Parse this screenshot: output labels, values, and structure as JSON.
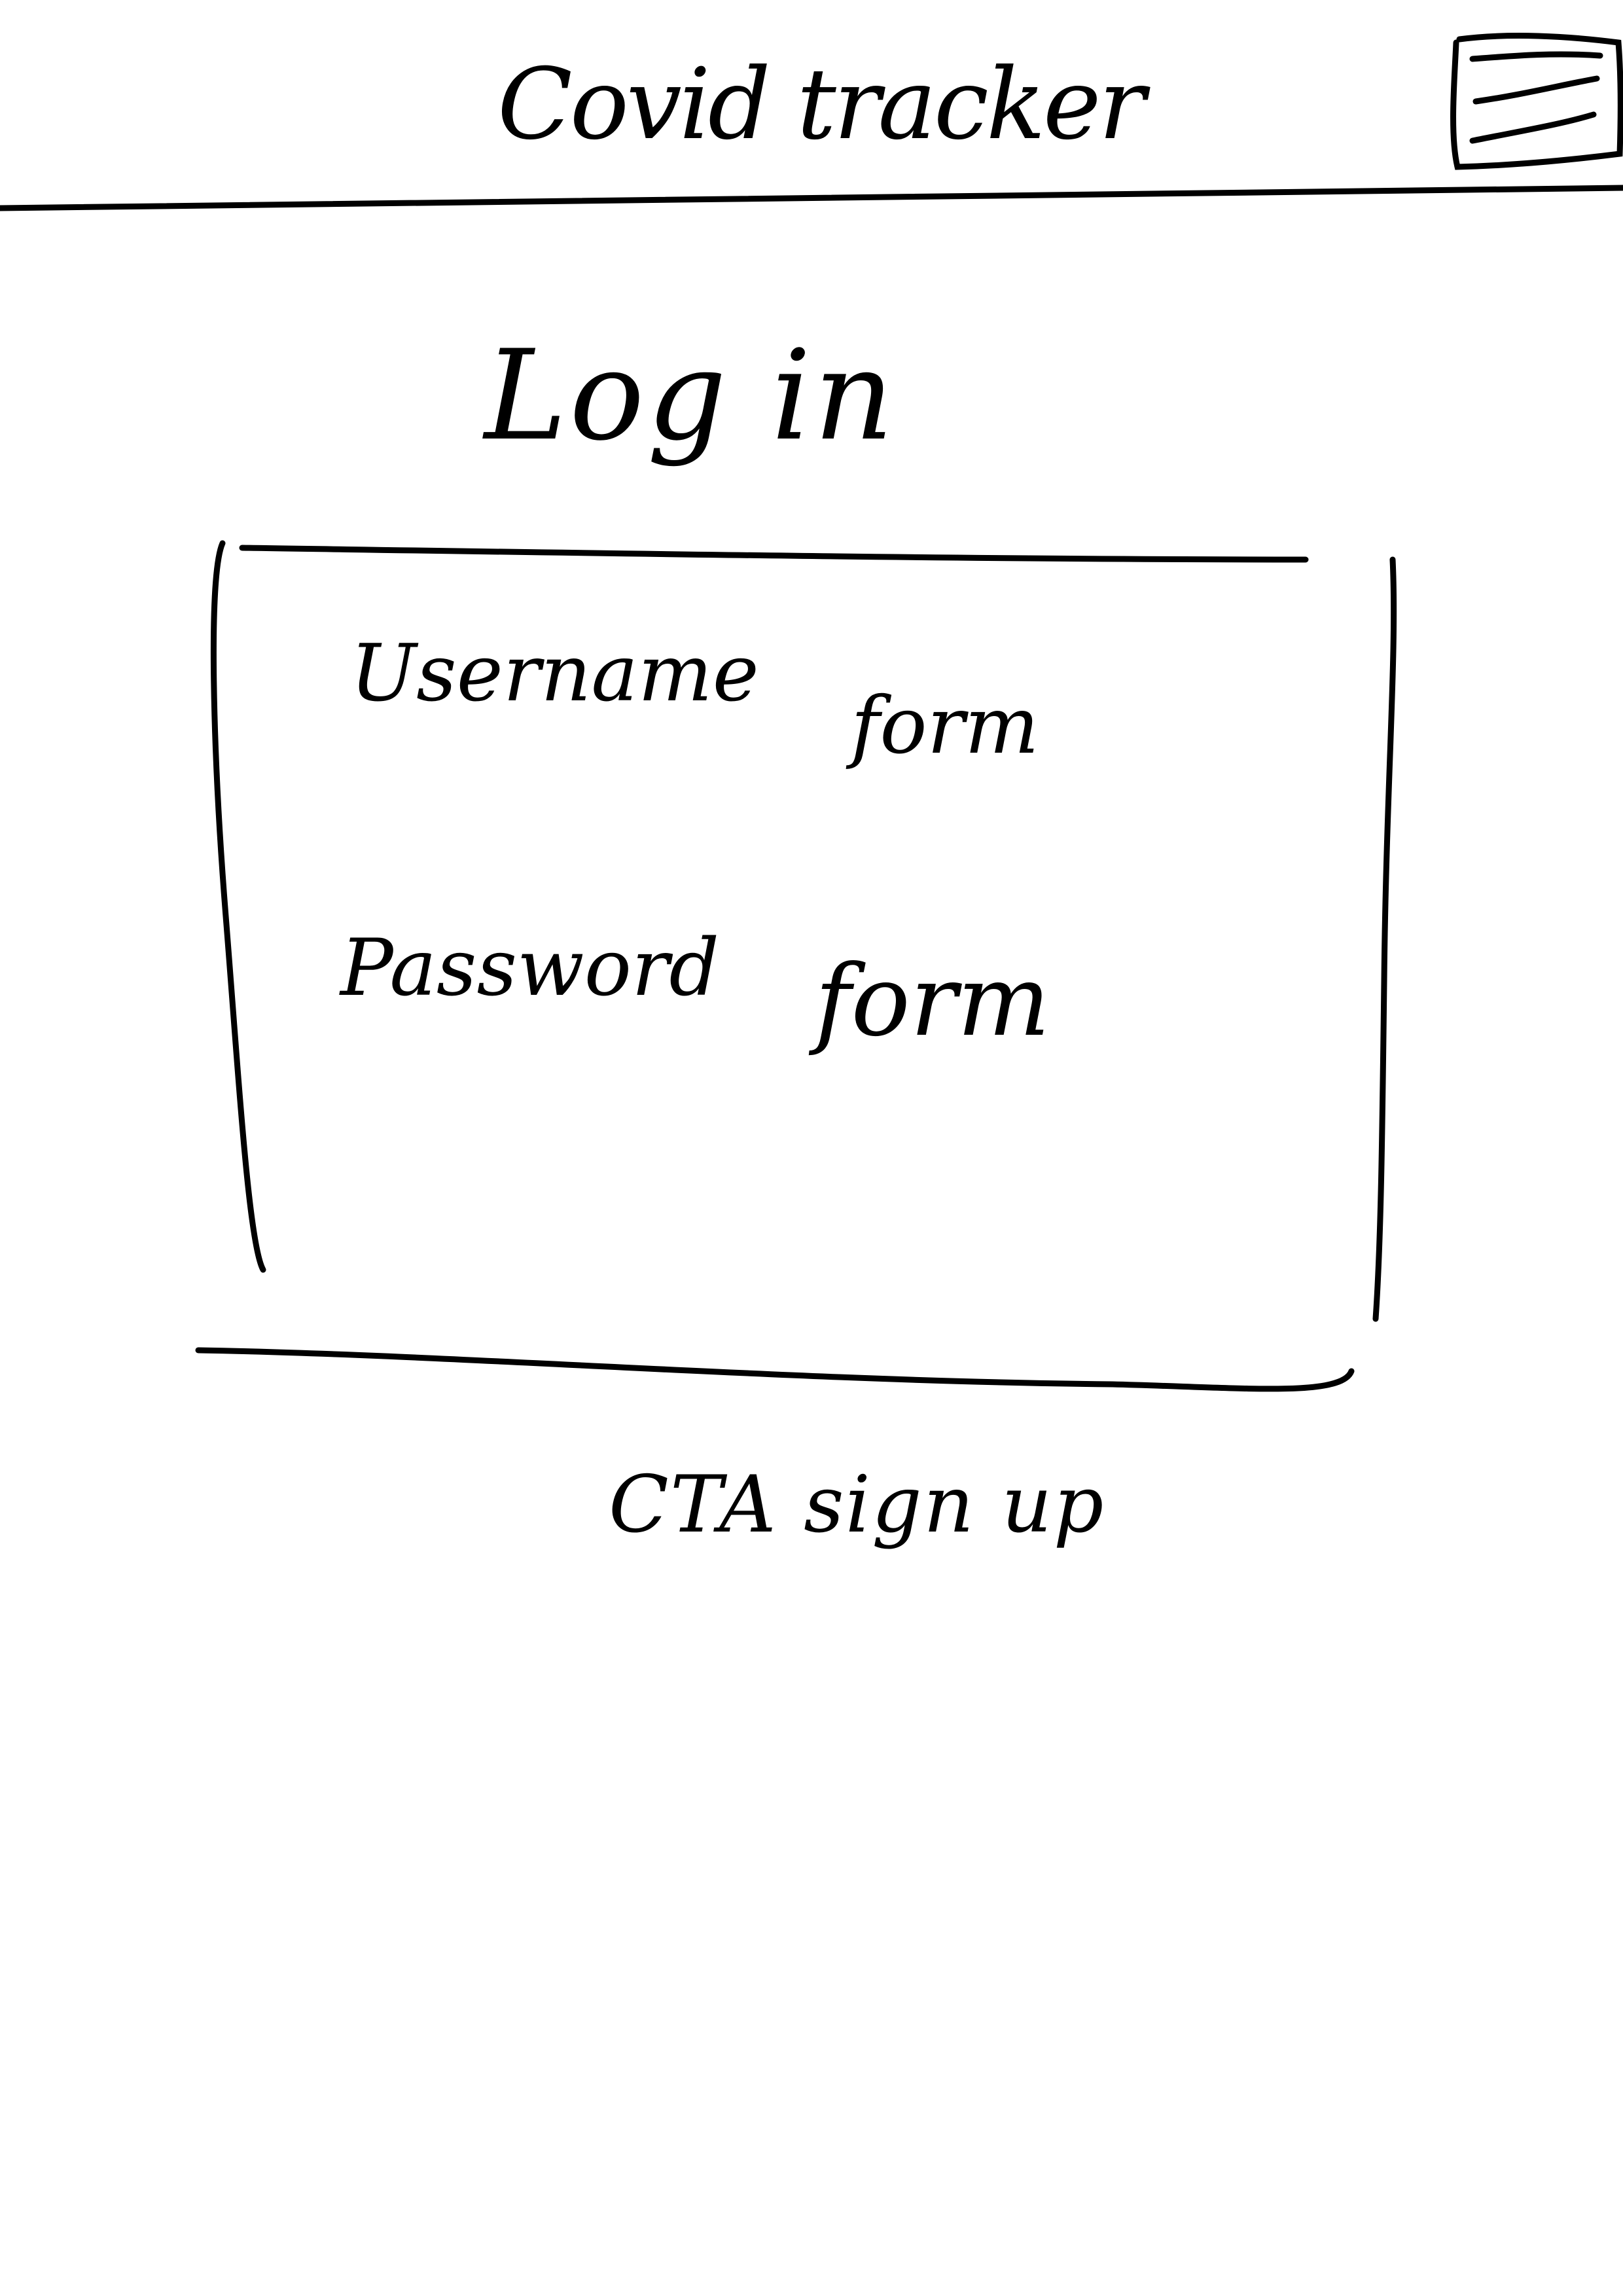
{
  "header": {
    "title": "Covid tracker",
    "menu_icon": "hamburger-menu-icon"
  },
  "login": {
    "heading": "Log in",
    "username_label": "Username",
    "username_field": "form",
    "password_label": "Password",
    "password_field": "form"
  },
  "cta": {
    "signup_label": "CTA sign up"
  },
  "colors": {
    "ink": "#000000",
    "paper": "#ffffff"
  }
}
